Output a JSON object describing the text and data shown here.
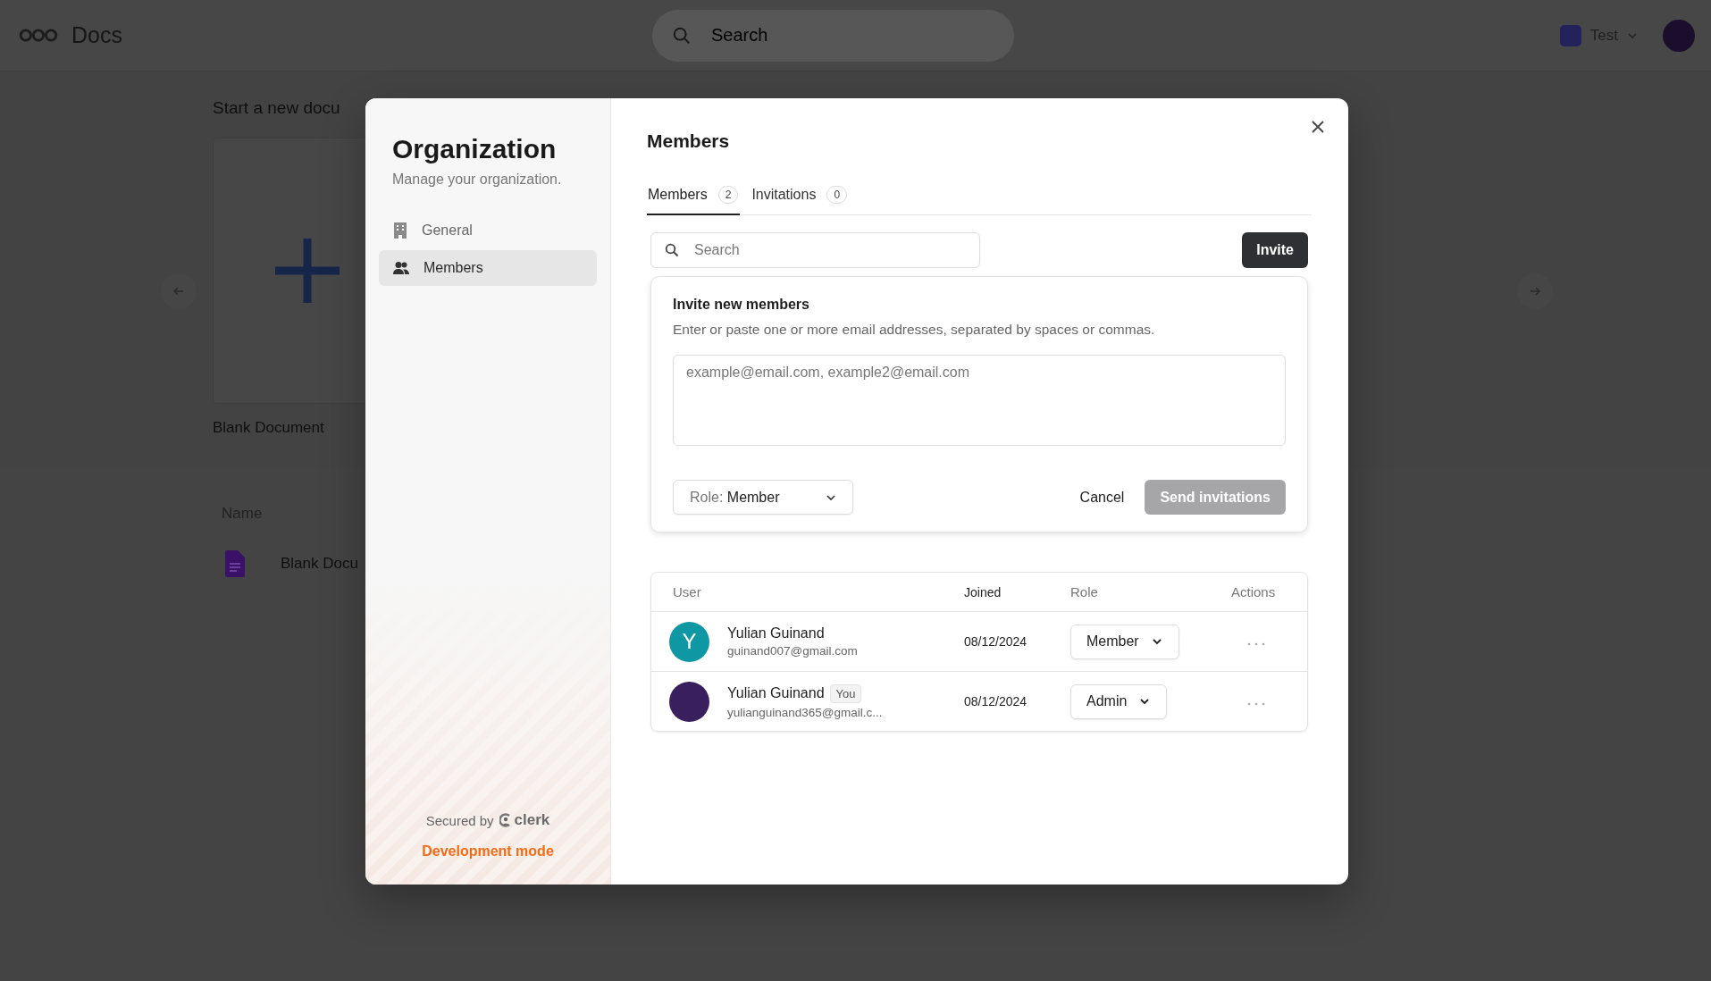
{
  "topbar": {
    "brand": "Docs",
    "search": {
      "placeholder": "Search"
    },
    "workspace": {
      "name": "Test"
    }
  },
  "background": {
    "heading": "Start a new docu",
    "templates": [
      {
        "label": "Blank Document"
      }
    ],
    "list": {
      "columns": [
        "Name"
      ],
      "rows": [
        {
          "name": "Blank Docu"
        }
      ]
    }
  },
  "modal": {
    "sidebar": {
      "title": "Organization",
      "subtitle": "Manage your organization.",
      "items": [
        {
          "label": "General",
          "kind": "building",
          "selected": false
        },
        {
          "label": "Members",
          "kind": "people",
          "selected": true
        }
      ],
      "secured_by": "Secured by",
      "brand": "clerk",
      "mode": "Development mode"
    },
    "title": "Members",
    "tabs": [
      {
        "label": "Members",
        "count": "2",
        "selected": true
      },
      {
        "label": "Invitations",
        "count": "0",
        "selected": false
      }
    ],
    "search": {
      "placeholder": "Search"
    },
    "invite_button": "Invite",
    "invite_panel": {
      "title": "Invite new members",
      "hint": "Enter or paste one or more email addresses, separated by spaces or commas.",
      "email_placeholder": "example@email.com, example2@email.com",
      "role_label": "Role:",
      "role_value": "Member",
      "cancel": "Cancel",
      "send": "Send invitations",
      "send_disabled": true
    },
    "table": {
      "columns": [
        "User",
        "Joined",
        "Role",
        "Actions"
      ],
      "rows": [
        {
          "kind": "letter",
          "initial": "Y",
          "name": "Yulian Guinand",
          "email": "guinand007@gmail.com",
          "joined": "08/12/2024",
          "role": "Member"
        },
        {
          "kind": "photo",
          "name": "Yulian Guinand",
          "badge": "You",
          "email": "yulianguinand365@gmail.c...",
          "joined": "08/12/2024",
          "role": "Admin"
        }
      ]
    }
  }
}
